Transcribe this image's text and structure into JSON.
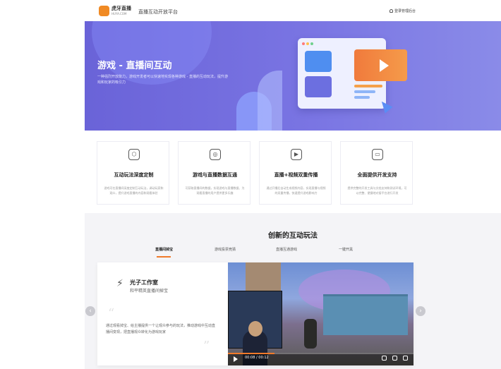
{
  "header": {
    "logo_name": "虎牙直播",
    "logo_sub": "HUYA.COM",
    "nav_title": "直播互动开放平台",
    "login": "登录管理后台"
  },
  "hero": {
    "title": "游戏 - 直播间互动",
    "description": "一种强烈开放能力，游戏开发者可以快速地实现各种游戏 - 直播的互动玩法，提升游戏和玩家的吸引力"
  },
  "features": [
    {
      "icon": "hexagon-gear-icon",
      "title": "互动玩法深度定制",
      "desc": "游戏可在直播间深度定制互动玩法，调动玩家和观众，提升游戏直播的内容和观看体验"
    },
    {
      "icon": "gamepad-icon",
      "title": "游戏与直播数据互通",
      "desc": "可获取直播间的数据，实现游戏与直播数据、为观看直播的用户提供更多乐趣"
    },
    {
      "icon": "video-camera-icon",
      "title": "直播+视频双重传播",
      "desc": "通过开播后自动生成视频内容，实现直播与视频的双重传播，快速提升游戏影响力"
    },
    {
      "icon": "monitor-icon",
      "title": "全面提供开发支持",
      "desc": "提供完整的开发工具与文档支持和测试环境，可以完整、便捷地对接平台进行开发"
    }
  ],
  "section": {
    "title": "创新的互动玩法",
    "tabs": [
      "直播间掉宝",
      "游戏投票竞猜",
      "直播互通游戏",
      "一键开黑"
    ],
    "active_tab": 0
  },
  "showcase": {
    "studio_name": "光子工作室",
    "studio_sub": "和平精英直播间掉宝",
    "description": "通过观看掉宝、给主播提供一个让观众参与的玩法，推动游戏中互动直播间变现，把直播观众转化为游戏玩家",
    "video_time": "00:08 / 00:12",
    "progress": 0.25
  },
  "colors": {
    "hero_start": "#6a63d8",
    "accent": "#f07a2a"
  }
}
